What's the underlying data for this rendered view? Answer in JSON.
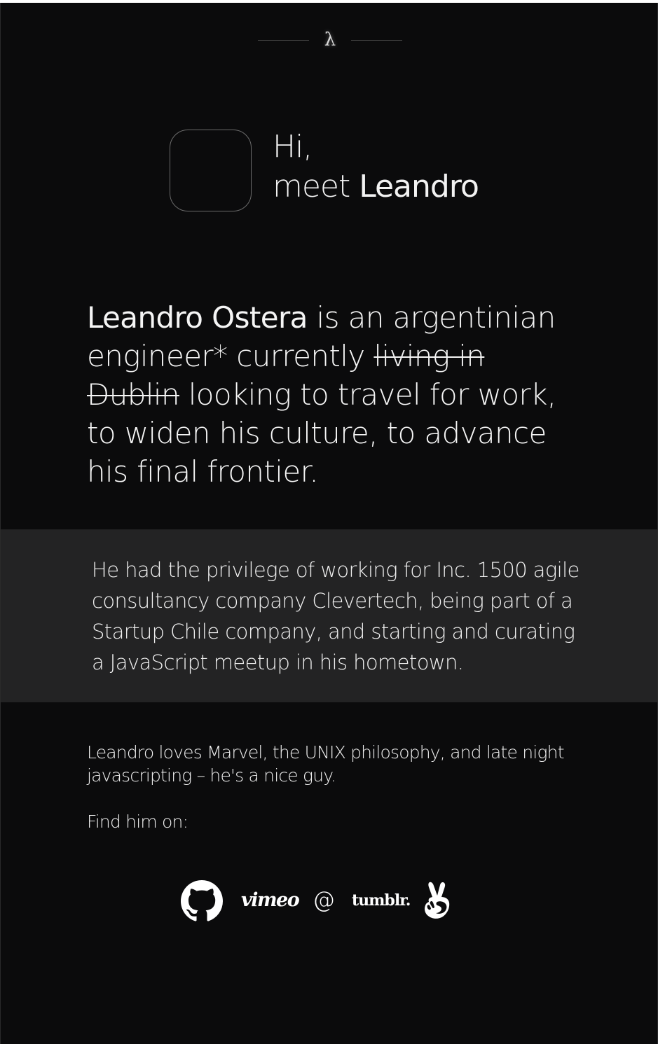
{
  "header": {
    "logo_glyph": "λ"
  },
  "intro": {
    "greeting_line1": "Hi,",
    "greeting_meet": "meet ",
    "greeting_name": "Leandro"
  },
  "bio": {
    "name": "Leandro Ostera",
    "text_1": " is an argentinian engineer* currently ",
    "struck": "living in Dublin",
    "text_2": " looking to travel for work, to widen his culture, to advance his final frontier."
  },
  "experience": {
    "text": "He had the privilege of working for Inc. 1500 agile consultancy company Clevertech, being part of a Startup Chile company, and starting and curating a JavaScript meetup in his hometown."
  },
  "about": {
    "loves": "Leandro loves Marvel, the UNIX philosophy, and late  night javascripting – he's a nice guy.",
    "find_label": "Find him on:"
  },
  "social": {
    "github": {
      "icon": "github-icon"
    },
    "vimeo": {
      "label": "vimeo"
    },
    "email": {
      "label": "@"
    },
    "tumblr": {
      "label": "tumblr."
    },
    "angellist": {
      "icon": "angellist-icon"
    }
  },
  "colors": {
    "background": "#0b0b0c",
    "band": "#232324",
    "text": "#f2f2f2"
  }
}
